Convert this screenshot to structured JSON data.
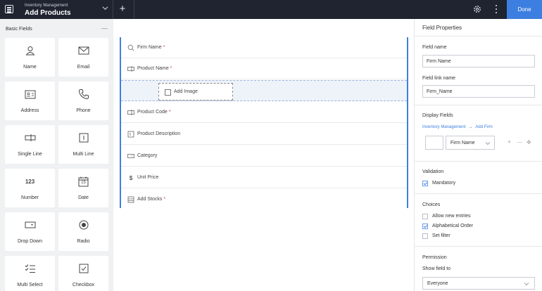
{
  "header": {
    "app_name": "Inventory Management",
    "form_title": "Add Products",
    "done_label": "Done",
    "icons": [
      "form-icon",
      "chevron-down-icon",
      "plus-icon",
      "gear-icon",
      "kebab-icon"
    ]
  },
  "palette": {
    "section_label": "Basic Fields",
    "collapse_symbol": "—",
    "items": [
      {
        "label": "Name",
        "icon": "person-icon"
      },
      {
        "label": "Email",
        "icon": "envelope-icon"
      },
      {
        "label": "Address",
        "icon": "address-card-icon"
      },
      {
        "label": "Phone",
        "icon": "phone-icon"
      },
      {
        "label": "Single Line",
        "icon": "single-line-icon"
      },
      {
        "label": "Multi Line",
        "icon": "multi-line-icon"
      },
      {
        "label": "Number",
        "icon": "number-icon",
        "icon_text": "123"
      },
      {
        "label": "Date",
        "icon": "calendar-icon",
        "icon_text": "15"
      },
      {
        "label": "Drop Down",
        "icon": "dropdown-icon"
      },
      {
        "label": "Radio",
        "icon": "radio-icon"
      },
      {
        "label": "Multi Select",
        "icon": "multi-select-icon"
      },
      {
        "label": "Checkbox",
        "icon": "checkbox-icon"
      }
    ]
  },
  "canvas": {
    "required_marker": "*",
    "dragging_label": "Add Image",
    "fields": [
      {
        "label": "Firm Name",
        "required": true,
        "icon": "search-icon"
      },
      {
        "label": "Product Name",
        "required": true,
        "icon": "single-line-icon"
      },
      {
        "label": "",
        "required": false,
        "icon": "",
        "drop_zone": true
      },
      {
        "label": "Product Code",
        "required": true,
        "icon": "single-line-icon"
      },
      {
        "label": "Product Description",
        "required": false,
        "icon": "multi-line-icon"
      },
      {
        "label": "Category",
        "required": false,
        "icon": "dropdown-icon"
      },
      {
        "label": "Unit Price",
        "required": false,
        "icon": "dollar-icon",
        "icon_text": "$"
      },
      {
        "label": "Add Stocks",
        "required": true,
        "icon": "subform-icon"
      }
    ]
  },
  "properties": {
    "title": "Field Properties",
    "field_name_label": "Field name",
    "field_name_value": "Firm Name",
    "field_link_label": "Field link name",
    "field_link_value": "Firm_Name",
    "display_fields_label": "Display Fields",
    "link_app": "Inventory Management",
    "link_arrow": "→",
    "link_form": "Add Firm",
    "display_field_value": "Firm Name",
    "add_symbol": "+",
    "remove_symbol": "—",
    "move_symbol": "✥",
    "validation_label": "Validation",
    "mandatory_label": "Mandatory",
    "mandatory_checked": true,
    "choices_label": "Choices",
    "choices": [
      {
        "label": "Allow new entries",
        "checked": false
      },
      {
        "label": "Alphabetical Order",
        "checked": true
      },
      {
        "label": "Set filter",
        "checked": false
      }
    ],
    "permission_label": "Permission",
    "show_field_label": "Show field to",
    "show_field_value": "Everyone"
  },
  "colors": {
    "accent": "#3d7fe0",
    "topbar": "#1f2430",
    "required": "#e03a3a",
    "palette_bg": "#f0f1f3"
  }
}
